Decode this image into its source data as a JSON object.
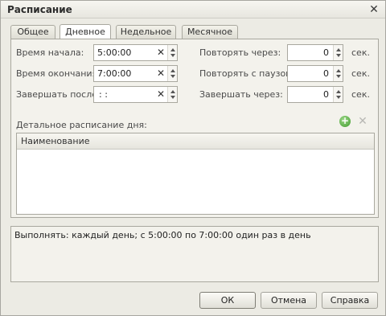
{
  "window": {
    "title": "Расписание"
  },
  "tabs": [
    {
      "label": "Общее"
    },
    {
      "label": "Дневное"
    },
    {
      "label": "Недельное"
    },
    {
      "label": "Месячное"
    }
  ],
  "daily": {
    "start_time": {
      "label": "Время начала:",
      "value": "5:00:00"
    },
    "end_time": {
      "label": "Время окончания:",
      "value": "7:00:00"
    },
    "finish_after": {
      "label": "Завершать после:",
      "value": ":  :"
    },
    "repeat_every": {
      "label": "Повторять через:",
      "value": "0",
      "unit": "сек."
    },
    "repeat_pause": {
      "label": "Повторять с паузой:",
      "value": "0",
      "unit": "сек."
    },
    "finish_in": {
      "label": "Завершать через:",
      "value": "0",
      "unit": "сек."
    }
  },
  "detail": {
    "label": "Детальное расписание дня:",
    "column_header": "Наименование",
    "rows": []
  },
  "summary": {
    "text": "Выполнять: каждый день; с 5:00:00 по 7:00:00 один раз в день"
  },
  "buttons": {
    "ok": "ОК",
    "cancel": "Отмена",
    "help": "Справка"
  }
}
